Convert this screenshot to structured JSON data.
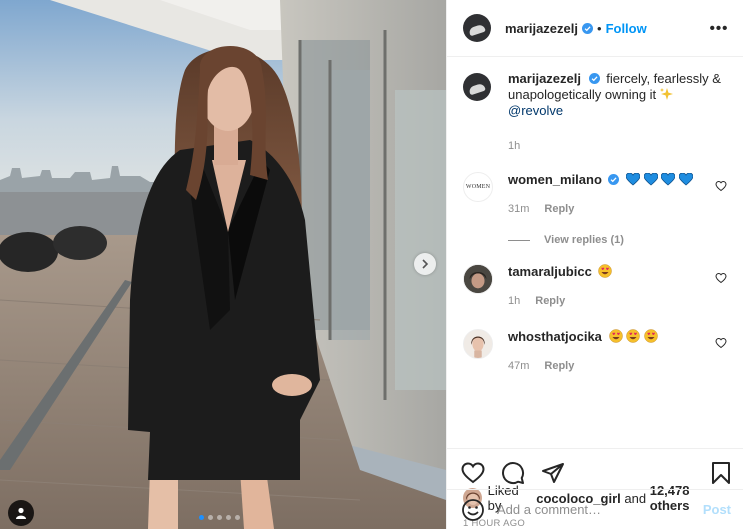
{
  "post": {
    "author": "marijazezelj",
    "separator": "•",
    "follow_label": "Follow",
    "more_label": "•••",
    "caption_text": "fiercely, fearlessly & unapologetically owning it",
    "caption_mention": "@revolve",
    "caption_time": "1h",
    "carousel": {
      "slides": 5,
      "active": 0
    }
  },
  "comments": [
    {
      "user": "women_milano",
      "verified": true,
      "avatar_text": "WOMEN",
      "text_emoji": "blue-heart x4",
      "time": "31m",
      "reply_label": "Reply",
      "view_replies": "View replies (1)"
    },
    {
      "user": "tamaraljubicc",
      "verified": false,
      "text_emoji": "heart-eyes x1",
      "time": "1h",
      "reply_label": "Reply"
    },
    {
      "user": "whosthatjocika",
      "verified": false,
      "text_emoji": "heart-eyes x3",
      "time": "47m",
      "reply_label": "Reply"
    }
  ],
  "likes": {
    "prefix": "Liked by",
    "user": "cocoloco_girl",
    "joiner": "and",
    "count": "12,478 others"
  },
  "date_label": "1 HOUR AGO",
  "add_comment": {
    "placeholder": "Add a comment…",
    "post_label": "Post"
  },
  "colors": {
    "accent": "#0095f6",
    "verified": "#3897f0",
    "muted": "#8e8e8e",
    "post_disabled": "#b2dffc"
  }
}
